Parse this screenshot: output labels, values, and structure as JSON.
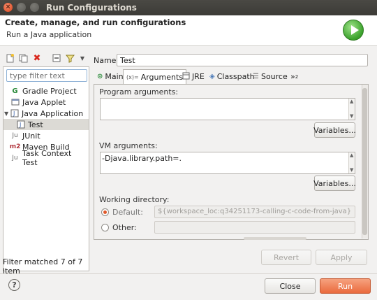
{
  "window": {
    "title": "Run Configurations"
  },
  "header": {
    "title": "Create, manage, and run configurations",
    "subtitle": "Run a Java application"
  },
  "left": {
    "filter_placeholder": "type filter text",
    "tree": [
      {
        "label": "Gradle Project",
        "icon": "G",
        "icon_name": "gradle-icon",
        "color": "#2a8a3a"
      },
      {
        "label": "Java Applet",
        "icon": "☕",
        "icon_name": "java-applet-icon",
        "color": "#6a5a3a"
      },
      {
        "label": "Java Application",
        "icon": "J",
        "icon_name": "java-application-icon",
        "color": "#3a62a8",
        "expanded": true
      },
      {
        "label": "Test",
        "icon": "J",
        "icon_name": "java-config-icon",
        "color": "#3a62a8",
        "selected": true
      },
      {
        "label": "JUnit",
        "icon": "Ju",
        "icon_name": "junit-icon",
        "color": "#6a6a6a"
      },
      {
        "label": "Maven Build",
        "icon": "m2",
        "icon_name": "maven-icon",
        "color": "#b0323a"
      },
      {
        "label": "Task Context Test",
        "icon": "Ju",
        "icon_name": "task-context-icon",
        "color": "#6a6a6a"
      }
    ],
    "status": "Filter matched 7 of 7 item"
  },
  "config": {
    "name_label": "Name:",
    "name_value": "Test",
    "tabs": [
      {
        "label": "Main",
        "icon": "Ⓒ"
      },
      {
        "label": "Arguments",
        "icon": "(x)="
      },
      {
        "label": "JRE",
        "icon": "▤"
      },
      {
        "label": "Classpath",
        "icon": "↯"
      },
      {
        "label": "Source",
        "icon": "⌸"
      },
      {
        "label": "»",
        "sub": "2"
      }
    ],
    "program_args_label": "Program arguments:",
    "program_args_value": "",
    "vm_args_label": "VM arguments:",
    "vm_args_value": "-Djava.library.path=.",
    "variables_label": "Variables...",
    "working_dir_label": "Working directory:",
    "default_label": "Default:",
    "default_value": "${workspace_loc:q34251173-calling-c-code-from-java}",
    "other_label": "Other:",
    "other_value": ""
  },
  "buttons": {
    "revert": "Revert",
    "apply": "Apply",
    "close": "Close",
    "run": "Run",
    "help": "?"
  },
  "colors": {
    "accent": "#e0582a",
    "run_button": "#ea6a3d",
    "selection": "#dcdad5"
  }
}
